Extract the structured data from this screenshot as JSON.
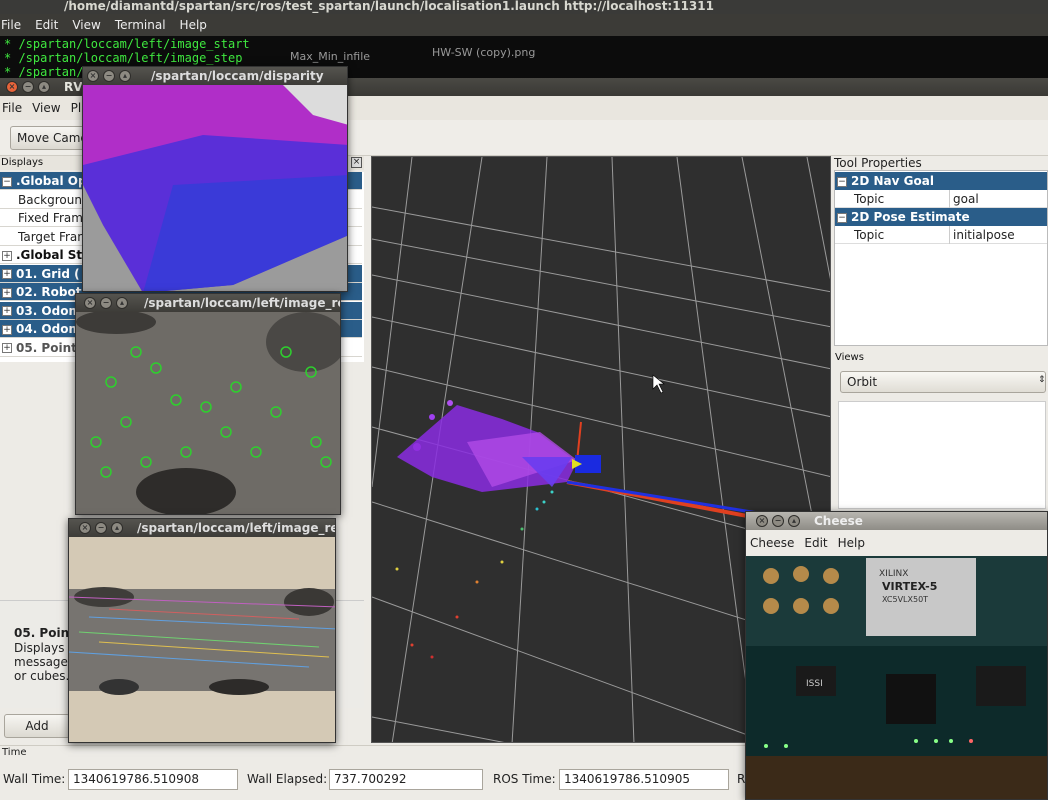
{
  "terminal": {
    "title": "/home/diamantd/spartan/src/ros/test_spartan/launch/localisation1.launch http://localhost:11311",
    "menu": [
      "File",
      "Edit",
      "View",
      "Terminal",
      "Help"
    ],
    "lines": [
      "* /spartan/loccam/left/image_start",
      "* /spartan/loccam/left/image_step",
      "* /spartan/l"
    ],
    "desktop_labels": [
      "Max_Min_infile",
      "HW-SW (copy).png"
    ]
  },
  "rviz": {
    "title": "RV",
    "menu": [
      "File",
      "View",
      "Plu"
    ],
    "toolbar": {
      "move_camera": "Move Came"
    },
    "displays": {
      "header": "Displays",
      "rows": [
        {
          "label": ".Global Op",
          "kind": "cat",
          "expander": "−"
        },
        {
          "label": "Backgroun",
          "kind": "prop"
        },
        {
          "label": "Fixed Fram",
          "kind": "prop"
        },
        {
          "label": "Target Fram",
          "kind": "prop"
        },
        {
          "label": ".Global St",
          "kind": "bold",
          "expander": "+"
        },
        {
          "label": "01. Grid (",
          "kind": "cat",
          "expander": "+"
        },
        {
          "label": "02. Robot",
          "kind": "cat",
          "expander": "+"
        },
        {
          "label": "03. Odom",
          "kind": "cat",
          "expander": "+"
        },
        {
          "label": "04. Odom",
          "kind": "cat",
          "expander": "+"
        },
        {
          "label": "05. Point",
          "kind": "gray",
          "expander": "+"
        }
      ],
      "help_title": "05. Point",
      "help_lines": [
        "Displays a",
        "message a",
        "or cubes."
      ],
      "add_button": "Add"
    },
    "tool_properties": {
      "header": "Tool Properties",
      "groups": [
        {
          "name": "2D Nav Goal",
          "prop": "Topic",
          "value": "goal"
        },
        {
          "name": "2D Pose Estimate",
          "prop": "Topic",
          "value": "initialpose"
        }
      ]
    },
    "views": {
      "header": "Views",
      "selected": "Orbit"
    },
    "time": {
      "header": "Time",
      "wall_time_label": "Wall Time:",
      "wall_time": "1340619786.510908",
      "wall_elapsed_label": "Wall Elapsed:",
      "wall_elapsed": "737.700292",
      "ros_time_label": "ROS Time:",
      "ros_time": "1340619786.510905",
      "r_label": "R"
    }
  },
  "windows": {
    "disparity": "/spartan/loccam/disparity",
    "image_re_1": "/spartan/loccam/left/image_re",
    "image_re_2": "/spartan/loccam/left/image_re",
    "cheese": {
      "title": "Cheese",
      "menu": [
        "Cheese",
        "Edit",
        "Help"
      ],
      "chip_text": [
        "XILINX",
        "VIRTEX-5",
        "XC5VLX50T"
      ],
      "chip_label": "ISSI"
    }
  },
  "colors": {
    "category_blue": "#2a5d89",
    "terminal_green": "#3fe83f",
    "close_orange": "#e8643a"
  }
}
